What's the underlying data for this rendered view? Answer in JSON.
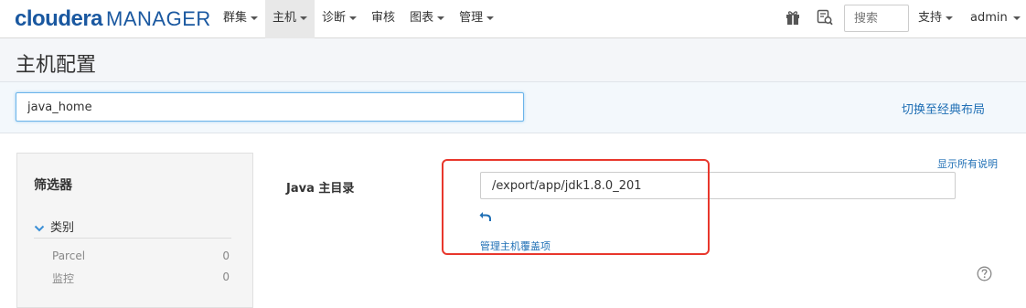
{
  "logo": {
    "brand": "cloudera",
    "product": "MANAGER"
  },
  "nav": {
    "items": [
      {
        "label": "群集",
        "active": false
      },
      {
        "label": "主机",
        "active": true
      },
      {
        "label": "诊断",
        "active": false
      },
      {
        "label": "审核",
        "active": false
      },
      {
        "label": "图表",
        "active": false
      },
      {
        "label": "管理",
        "active": false
      }
    ],
    "search_placeholder": "搜索",
    "support_label": "支持",
    "user_label": "admin"
  },
  "page": {
    "title": "主机配置"
  },
  "filter": {
    "search_value": "java_home",
    "switch_layout_label": "切换至经典布局"
  },
  "sidebar": {
    "title": "筛选器",
    "category_label": "类别",
    "items": [
      {
        "label": "Parcel",
        "count": "0"
      },
      {
        "label": "监控",
        "count": "0"
      }
    ]
  },
  "config": {
    "show_all_label": "显示所有说明",
    "property_label": "Java 主目录",
    "property_value": "/export/app/jdk1.8.0_201",
    "override_label": "管理主机覆盖项"
  },
  "colors": {
    "brand": "#1a58a0",
    "link": "#1f6fb5",
    "highlight": "#e8372c"
  },
  "icons": [
    "gift-icon",
    "task-search-icon",
    "undo-icon",
    "help-icon",
    "chevron-down-icon"
  ]
}
